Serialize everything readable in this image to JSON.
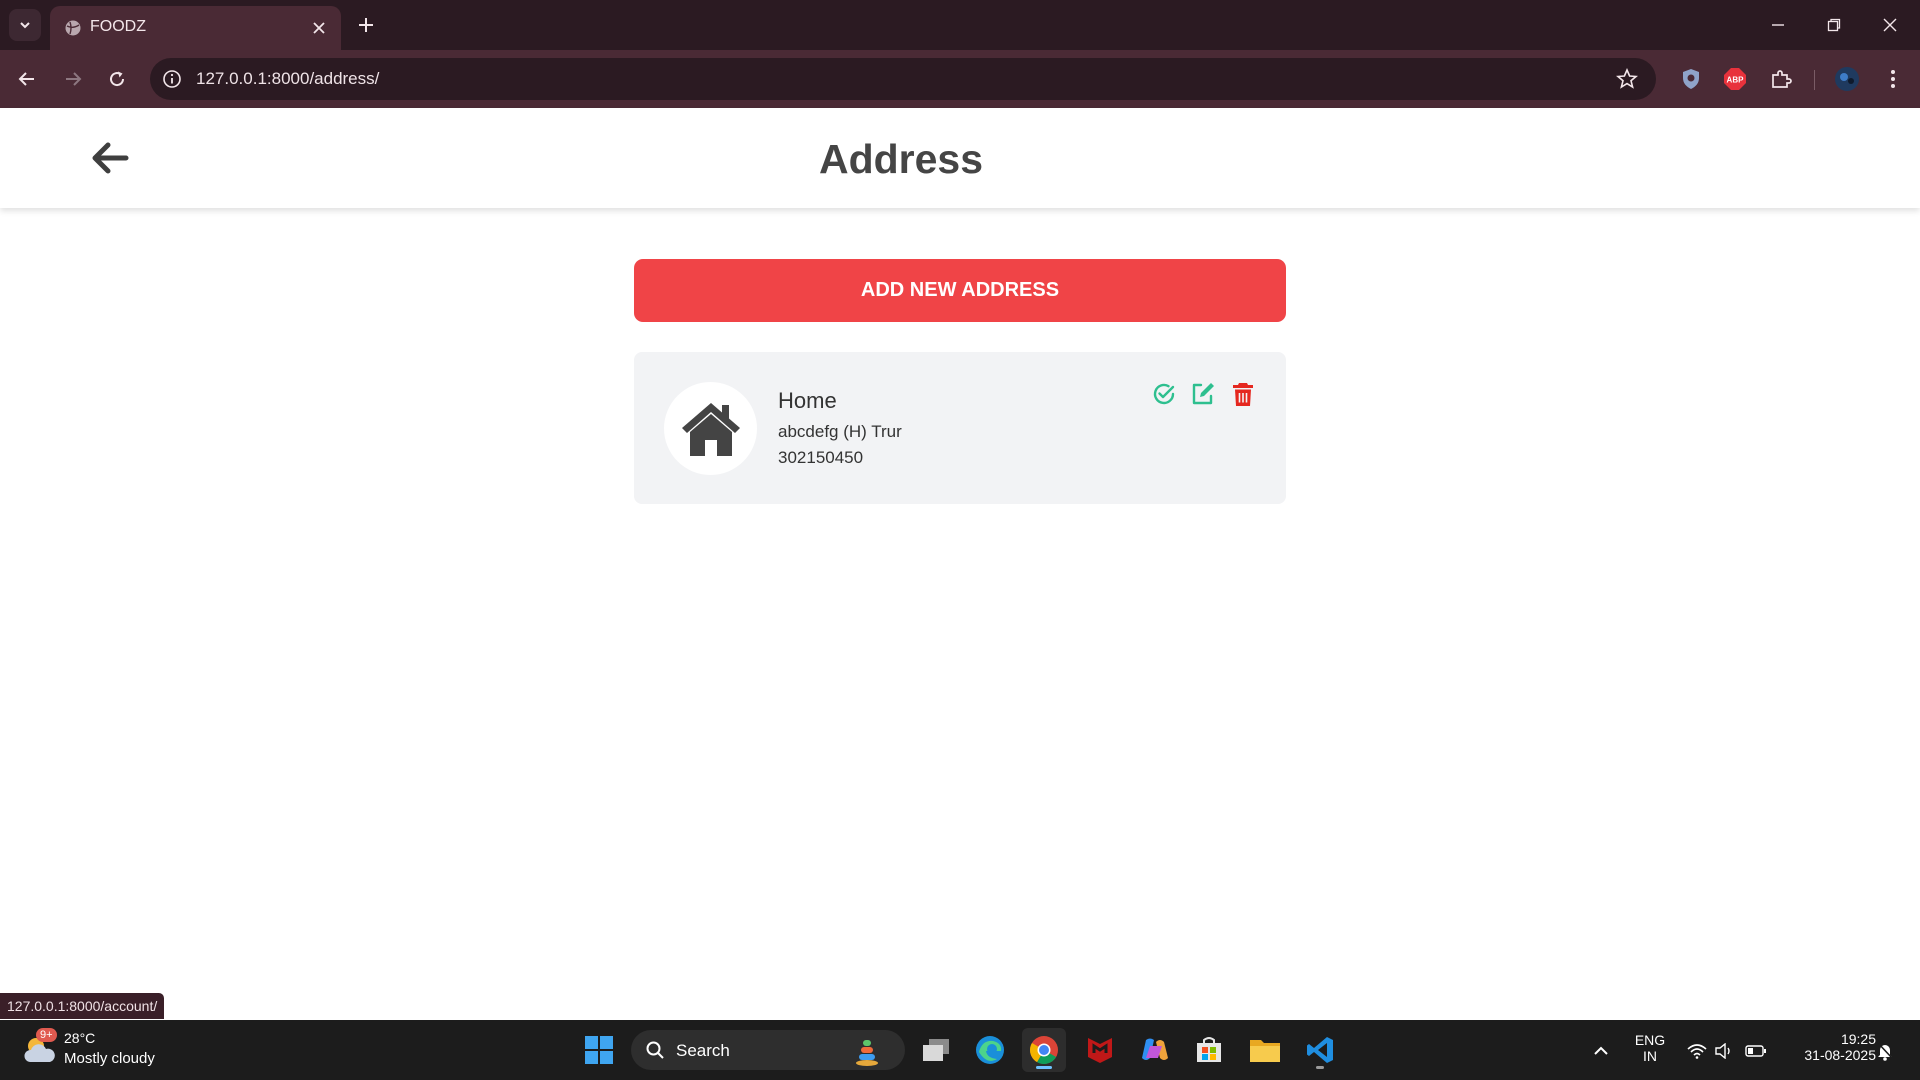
{
  "browser": {
    "tab_title": "FOODZ",
    "url": "127.0.0.1:8000/address/",
    "status_url": "127.0.0.1:8000/account/",
    "abp_label": "ABP"
  },
  "page": {
    "title": "Address",
    "add_button_label": "ADD NEW ADDRESS"
  },
  "addresses": [
    {
      "name": "Home",
      "line": "abcdefg (H) Trur",
      "phone": "302150450"
    }
  ],
  "colors": {
    "accent_red": "#f04447",
    "action_green": "#2ebf8f",
    "delete_red": "#e5271f",
    "chrome_dark": "#2b1a22",
    "chrome_toolbar": "#4a2a35"
  },
  "taskbar": {
    "weather_temp": "28°C",
    "weather_desc": "Mostly cloudy",
    "weather_badge": "9+",
    "search_label": "Search",
    "lang_top": "ENG",
    "lang_bottom": "IN",
    "time": "19:25",
    "date": "31-08-2025"
  },
  "icons": {
    "tab_list": "chevron-down-icon",
    "favicon": "globe-icon",
    "back": "arrow-left-icon",
    "forward": "arrow-right-icon",
    "reload": "reload-icon",
    "site_info": "info-icon",
    "bookmark": "star-icon",
    "address_avatar": "home-icon",
    "select_address": "check-circle-icon",
    "edit_address": "edit-icon",
    "delete_address": "trash-icon"
  }
}
